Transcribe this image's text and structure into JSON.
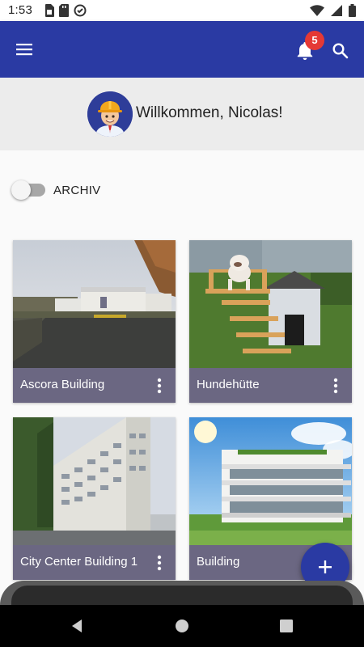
{
  "status_bar": {
    "time": "1:53",
    "left_icons": [
      "sim-icon",
      "sd-card-icon",
      "sync-icon"
    ],
    "right_icons": [
      "wifi-icon",
      "signal-icon",
      "battery-icon"
    ]
  },
  "app_bar": {
    "color": "#2a3aa3",
    "notification_count": "5",
    "icons": [
      "menu-icon",
      "bell-icon",
      "search-icon"
    ]
  },
  "welcome": {
    "text": "Willkommen, Nicolas!"
  },
  "archive": {
    "label": "ARCHIV",
    "checked": false
  },
  "projects": [
    {
      "title": "Ascora Building"
    },
    {
      "title": "Hundehütte"
    },
    {
      "title": "City Center Building 1"
    },
    {
      "title": "Building"
    }
  ],
  "fab": {
    "icon": "plus-icon"
  },
  "nav_bar": {
    "icons": [
      "back-icon",
      "home-icon",
      "recents-icon"
    ]
  }
}
